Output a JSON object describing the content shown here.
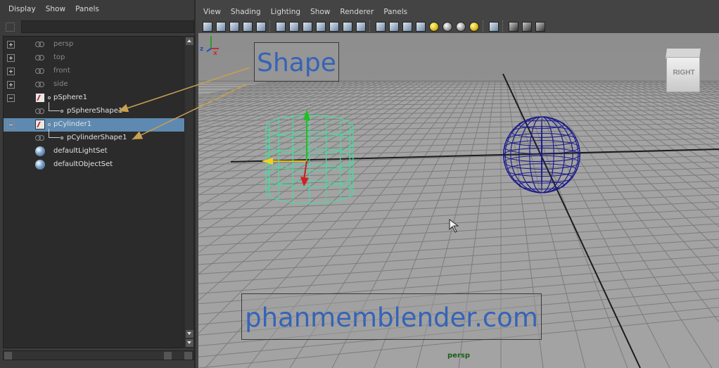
{
  "outliner": {
    "menu": [
      "Display",
      "Show",
      "Panels"
    ],
    "filter_value": "",
    "items": [
      {
        "label": "persp",
        "kind": "camera",
        "expander": "plus",
        "dim": true
      },
      {
        "label": "top",
        "kind": "camera",
        "expander": "plus",
        "dim": true
      },
      {
        "label": "front",
        "kind": "camera",
        "expander": "plus",
        "dim": true
      },
      {
        "label": "side",
        "kind": "camera",
        "expander": "plus",
        "dim": true
      },
      {
        "label": "pSphere1",
        "kind": "transform",
        "expander": "minus",
        "dim": false
      },
      {
        "label": "pSphereShape1",
        "kind": "shape",
        "expander": "none",
        "dim": false
      },
      {
        "label": "pCylinder1",
        "kind": "transform",
        "expander": "minus",
        "dim": false,
        "selected": true
      },
      {
        "label": "pCylinderShape1",
        "kind": "shape",
        "expander": "none",
        "dim": false
      },
      {
        "label": "defaultLightSet",
        "kind": "set",
        "expander": "none",
        "dim": false
      },
      {
        "label": "defaultObjectSet",
        "kind": "set",
        "expander": "none",
        "dim": false
      }
    ]
  },
  "viewport": {
    "menu": [
      "View",
      "Shading",
      "Lighting",
      "Show",
      "Renderer",
      "Panels"
    ],
    "camera_label": "persp",
    "viewcube_label": "RIGHT",
    "axis_labels": {
      "z": "z",
      "x": "x"
    }
  },
  "annotations": {
    "shape_label": "Shape",
    "watermark": "phanmemblender.com"
  },
  "colors": {
    "selection": "#5e89b0",
    "cylinder_wire": "#3fe0a0",
    "sphere_wire": "#1a1a8c",
    "annotation_text": "#3563b8",
    "arrow": "#c8a050"
  }
}
